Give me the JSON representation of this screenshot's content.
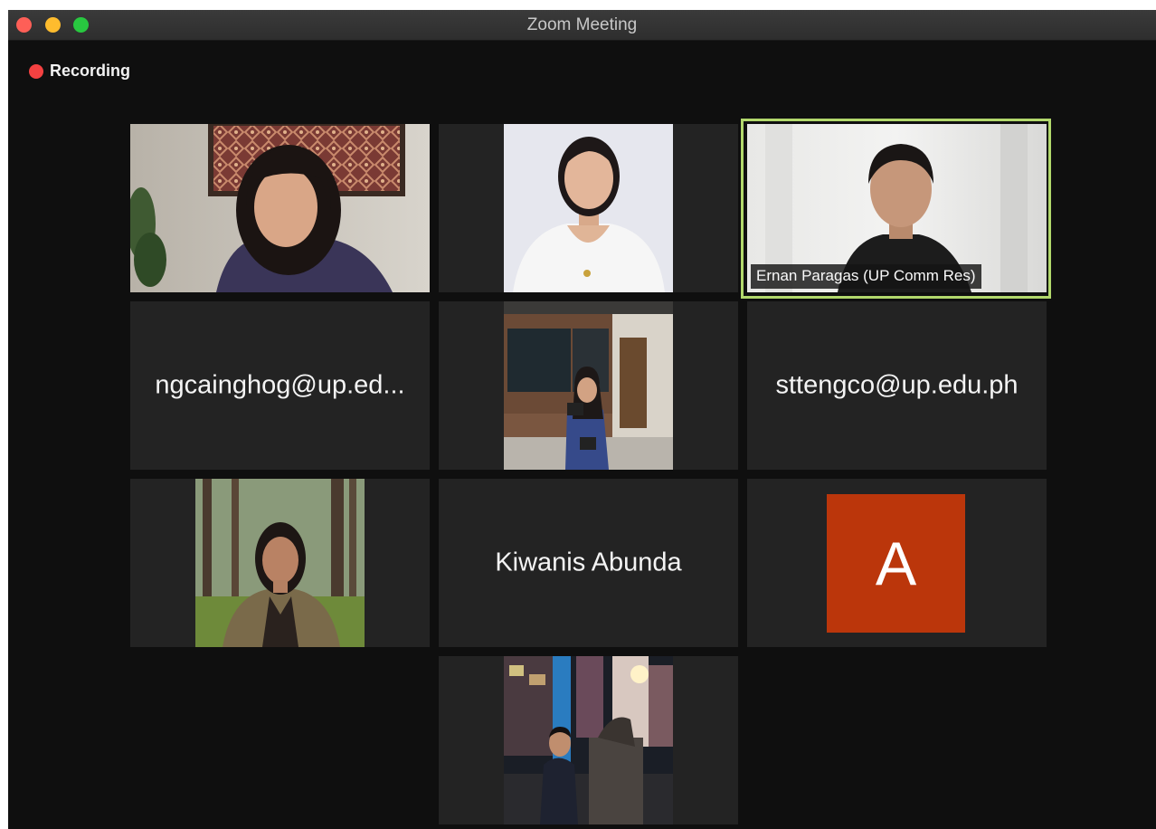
{
  "window": {
    "title": "Zoom Meeting"
  },
  "recording": {
    "label": "Recording"
  },
  "active_speaker": {
    "name": "Ernan Paragas (UP Comm Res)"
  },
  "tiles": {
    "row2_left": {
      "name": "ngcainghog@up.ed..."
    },
    "row2_right": {
      "name": "sttengco@up.edu.ph"
    },
    "row3_center": {
      "name": "Kiwanis Abunda"
    },
    "row3_right": {
      "avatar_letter": "A"
    }
  },
  "colors": {
    "recording_dot": "#f44141",
    "active_speaker_border": "#b2d86c",
    "avatar_bg": "#bb360b"
  }
}
